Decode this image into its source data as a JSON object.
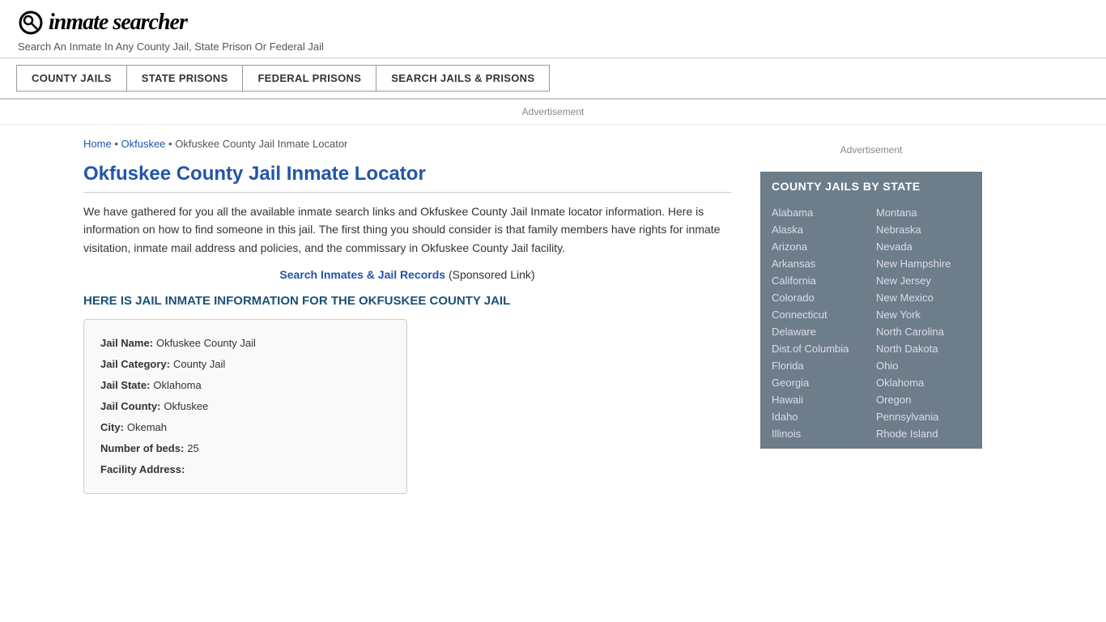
{
  "header": {
    "logo_icon": "🔍",
    "logo_text": "inmate searcher",
    "tagline": "Search An Inmate In Any County Jail, State Prison Or Federal Jail"
  },
  "nav": {
    "items": [
      {
        "id": "county-jails",
        "label": "COUNTY JAILS"
      },
      {
        "id": "state-prisons",
        "label": "STATE PRISONS"
      },
      {
        "id": "federal-prisons",
        "label": "FEDERAL PRISONS"
      },
      {
        "id": "search-jails-prisons",
        "label": "SEARCH JAILS & PRISONS"
      }
    ]
  },
  "ad_top": "Advertisement",
  "breadcrumb": {
    "home_label": "Home",
    "home_href": "#",
    "separator1": "•",
    "okfuskee_label": "Okfuskee",
    "okfuskee_href": "#",
    "separator2": "•",
    "current": "Okfuskee County Jail Inmate Locator"
  },
  "page_title": "Okfuskee County Jail Inmate Locator",
  "description": "We have gathered for you all the available inmate search links and Okfuskee County Jail Inmate locator information. Here is information on how to find someone in this jail. The first thing you should consider is that family members have rights for inmate visitation, inmate mail address and policies, and the commissary in Okfuskee County Jail facility.",
  "sponsored": {
    "link_text": "Search Inmates & Jail Records",
    "note": "(Sponsored Link)"
  },
  "section_heading": "HERE IS JAIL INMATE INFORMATION FOR THE OKFUSKEE COUNTY JAIL",
  "jail_info": {
    "name_label": "Jail Name:",
    "name_value": "Okfuskee County Jail",
    "category_label": "Jail Category:",
    "category_value": "County Jail",
    "state_label": "Jail State:",
    "state_value": "Oklahoma",
    "county_label": "Jail County:",
    "county_value": "Okfuskee",
    "city_label": "City:",
    "city_value": "Okemah",
    "beds_label": "Number of beds:",
    "beds_value": "25",
    "address_label": "Facility Address:"
  },
  "sidebar": {
    "ad_label": "Advertisement",
    "state_box_title": "COUNTY JAILS BY STATE",
    "states_left": [
      "Alabama",
      "Alaska",
      "Arizona",
      "Arkansas",
      "California",
      "Colorado",
      "Connecticut",
      "Delaware",
      "Dist.of Columbia",
      "Florida",
      "Georgia",
      "Hawaii",
      "Idaho",
      "Illinois"
    ],
    "states_right": [
      "Montana",
      "Nebraska",
      "Nevada",
      "New Hampshire",
      "New Jersey",
      "New Mexico",
      "New York",
      "North Carolina",
      "North Dakota",
      "Ohio",
      "Oklahoma",
      "Oregon",
      "Pennsylvania",
      "Rhode Island"
    ]
  }
}
